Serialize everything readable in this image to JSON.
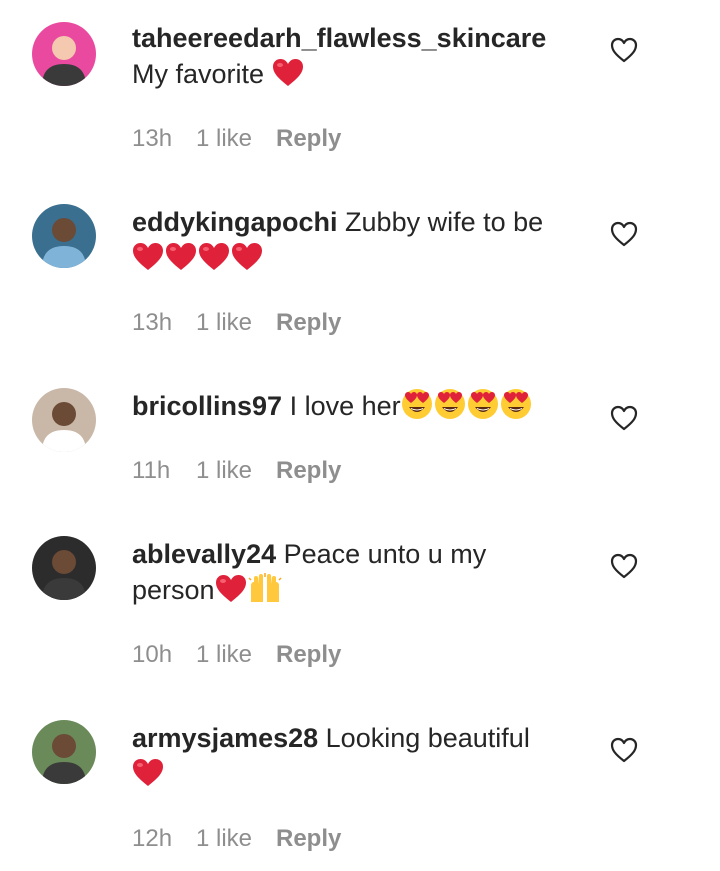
{
  "comments": [
    {
      "username": "taheereedarh_flawless_skincare",
      "text": "",
      "line2": "My favorite",
      "emojis_line2": [
        "heart"
      ],
      "emojis_line1": [],
      "time": "13h",
      "likes": "1 like",
      "reply": "Reply",
      "avatar_color": "#e94aa0"
    },
    {
      "username": "eddykingapochi",
      "text": " Zubby wife to be",
      "line2": "",
      "emojis_line1": [],
      "emojis_line2": [
        "heart",
        "heart",
        "heart",
        "heart"
      ],
      "time": "13h",
      "likes": "1 like",
      "reply": "Reply",
      "avatar_color": "#3a6f8f"
    },
    {
      "username": "bricollins97",
      "text": " I love her",
      "line2": "",
      "emojis_line1": [
        "heart-eyes",
        "heart-eyes",
        "heart-eyes",
        "heart-eyes"
      ],
      "emojis_line2": [],
      "time": "11h",
      "likes": "1 like",
      "reply": "Reply",
      "avatar_color": "#c9b8a8"
    },
    {
      "username": "ablevally24",
      "text": " Peace unto u my",
      "line2": "person",
      "emojis_line1": [],
      "emojis_line2": [
        "heart",
        "raised-hands"
      ],
      "time": "10h",
      "likes": "1 like",
      "reply": "Reply",
      "avatar_color": "#2c2c2c"
    },
    {
      "username": "armysjames28",
      "text": " Looking beautiful",
      "line2": "",
      "emojis_line1": [],
      "emojis_line2": [
        "heart"
      ],
      "time": "12h",
      "likes": "1 like",
      "reply": "Reply",
      "avatar_color": "#6a8a5a"
    }
  ],
  "colors": {
    "text": "#262626",
    "meta": "#8e8e8e",
    "heart_emoji": "#e0213a"
  }
}
